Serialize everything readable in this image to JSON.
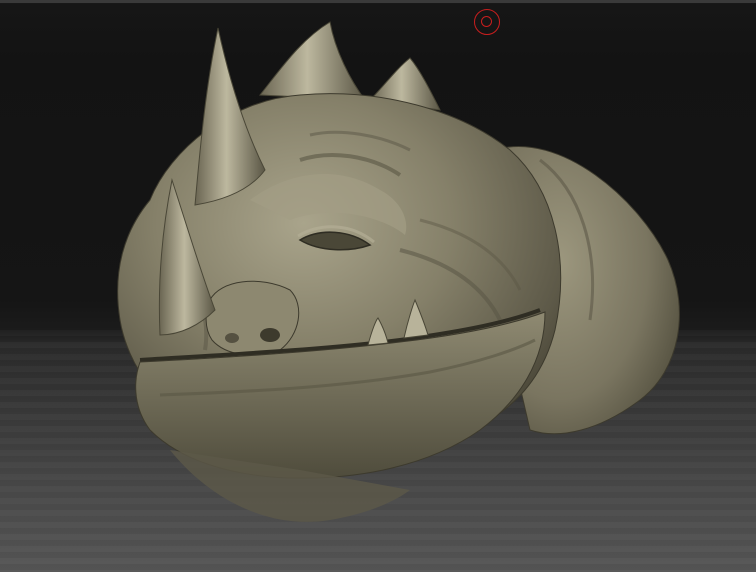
{
  "viewport": {
    "description_hidden": "",
    "colors": {
      "background_top": "#131313",
      "background_floor": "#555555",
      "clay": "#7d7863",
      "clay_light": "#a9a48b",
      "clay_dark": "#3d3a2d",
      "brush_cursor": "#c81e1e"
    }
  },
  "model": {
    "icon": "sculpt-mesh-icon"
  },
  "brush_cursor": {
    "icon": "brush-cursor-icon"
  }
}
